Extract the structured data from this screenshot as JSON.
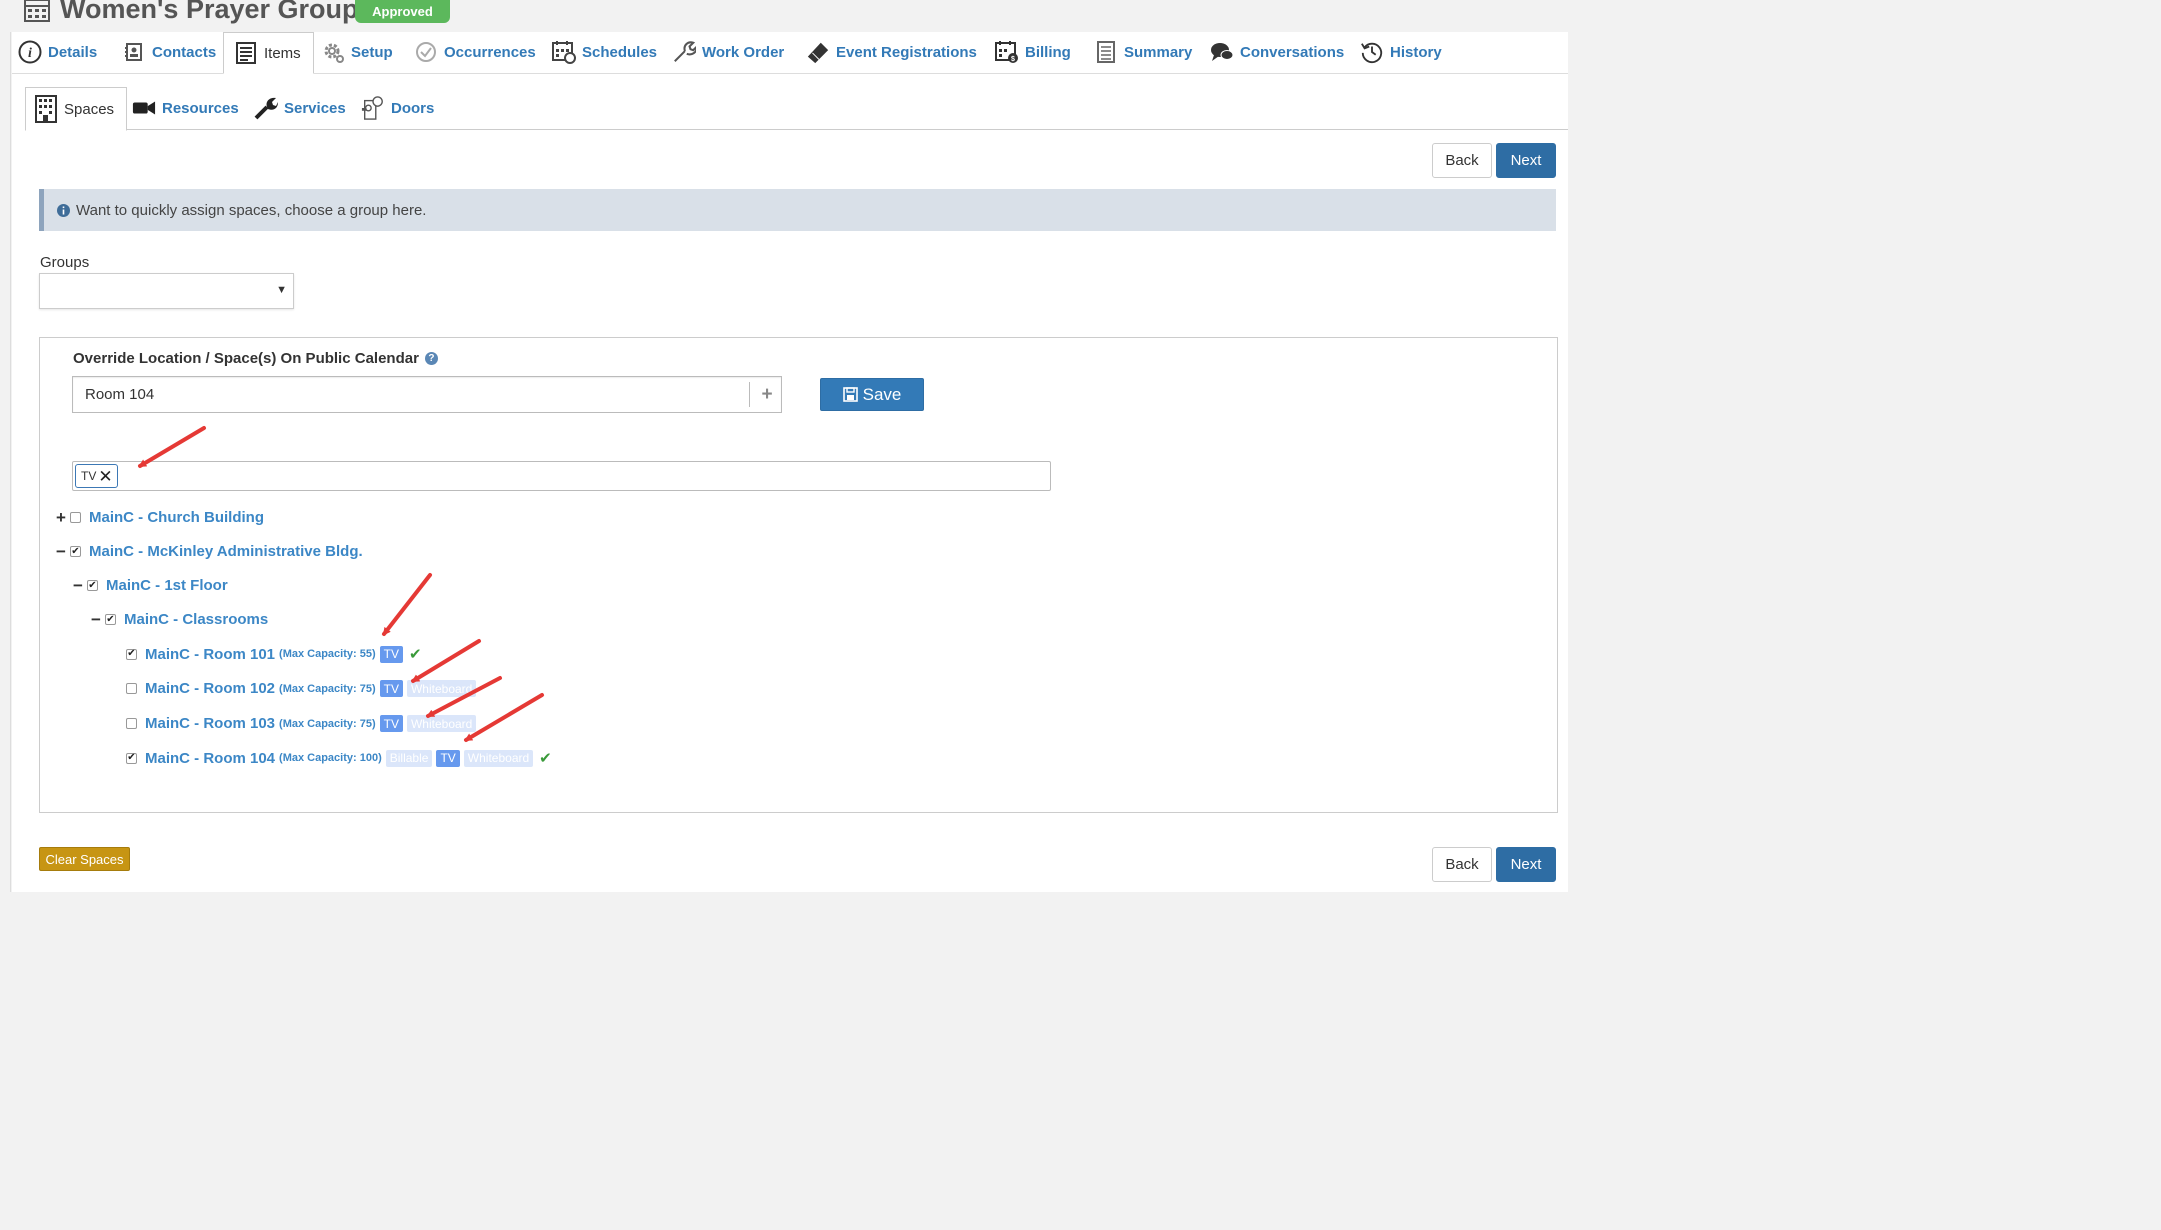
{
  "header": {
    "title": "Women's Prayer Group",
    "status": "Approved"
  },
  "main_tabs": [
    {
      "label": "Details",
      "icon": "info-circle-icon"
    },
    {
      "label": "Contacts",
      "icon": "contacts-icon"
    },
    {
      "label": "Items",
      "icon": "list-icon",
      "active": true
    },
    {
      "label": "Setup",
      "icon": "gear-icon"
    },
    {
      "label": "Occurrences",
      "icon": "check-clock-icon"
    },
    {
      "label": "Schedules",
      "icon": "calendar-icon"
    },
    {
      "label": "Work Order",
      "icon": "wrench-icon"
    },
    {
      "label": "Event Registrations",
      "icon": "ticket-icon"
    },
    {
      "label": "Billing",
      "icon": "billing-calendar-icon"
    },
    {
      "label": "Summary",
      "icon": "document-icon"
    },
    {
      "label": "Conversations",
      "icon": "chat-icon"
    },
    {
      "label": "History",
      "icon": "history-icon"
    }
  ],
  "sub_tabs": [
    {
      "label": "Spaces",
      "icon": "building-icon",
      "active": true
    },
    {
      "label": "Resources",
      "icon": "video-camera-icon"
    },
    {
      "label": "Services",
      "icon": "wrench-icon"
    },
    {
      "label": "Doors",
      "icon": "door-icon"
    }
  ],
  "nav": {
    "back": "Back",
    "next": "Next"
  },
  "info": {
    "text": "Want to quickly assign spaces, choose a group here."
  },
  "groups": {
    "label": "Groups",
    "value": ""
  },
  "override": {
    "label": "Override Location / Space(s) On Public Calendar",
    "value": "Room 104",
    "save": "Save"
  },
  "filter": {
    "tags": [
      "TV"
    ]
  },
  "tree": {
    "church": "MainC - Church Building",
    "mckinley": "MainC - McKinley Administrative Bldg.",
    "floor1": "MainC - 1st Floor",
    "classrooms": "MainC - Classrooms",
    "rooms": [
      {
        "name": "MainC - Room 101",
        "capacity": "(Max Capacity: 55)",
        "checked": true,
        "tags": [
          {
            "t": "TV",
            "on": true
          }
        ],
        "selected": true
      },
      {
        "name": "MainC - Room 102",
        "capacity": "(Max Capacity: 75)",
        "checked": false,
        "tags": [
          {
            "t": "TV",
            "on": true
          },
          {
            "t": "Whiteboard",
            "on": false
          }
        ],
        "selected": false
      },
      {
        "name": "MainC - Room 103",
        "capacity": "(Max Capacity: 75)",
        "checked": false,
        "tags": [
          {
            "t": "TV",
            "on": true
          },
          {
            "t": "Whiteboard",
            "on": false
          }
        ],
        "selected": false
      },
      {
        "name": "MainC - Room 104",
        "capacity": "(Max Capacity: 100)",
        "checked": true,
        "tags": [
          {
            "t": "Billable",
            "on": false
          },
          {
            "t": "TV",
            "on": true
          },
          {
            "t": "Whiteboard",
            "on": false
          }
        ],
        "selected": true
      }
    ]
  },
  "footer": {
    "clear": "Clear Spaces"
  },
  "colors": {
    "primary": "#337ab7",
    "approved": "#5cb85c",
    "warning": "#c79513",
    "annotation_arrow": "#e53935",
    "tag_active": "#6699ee"
  }
}
